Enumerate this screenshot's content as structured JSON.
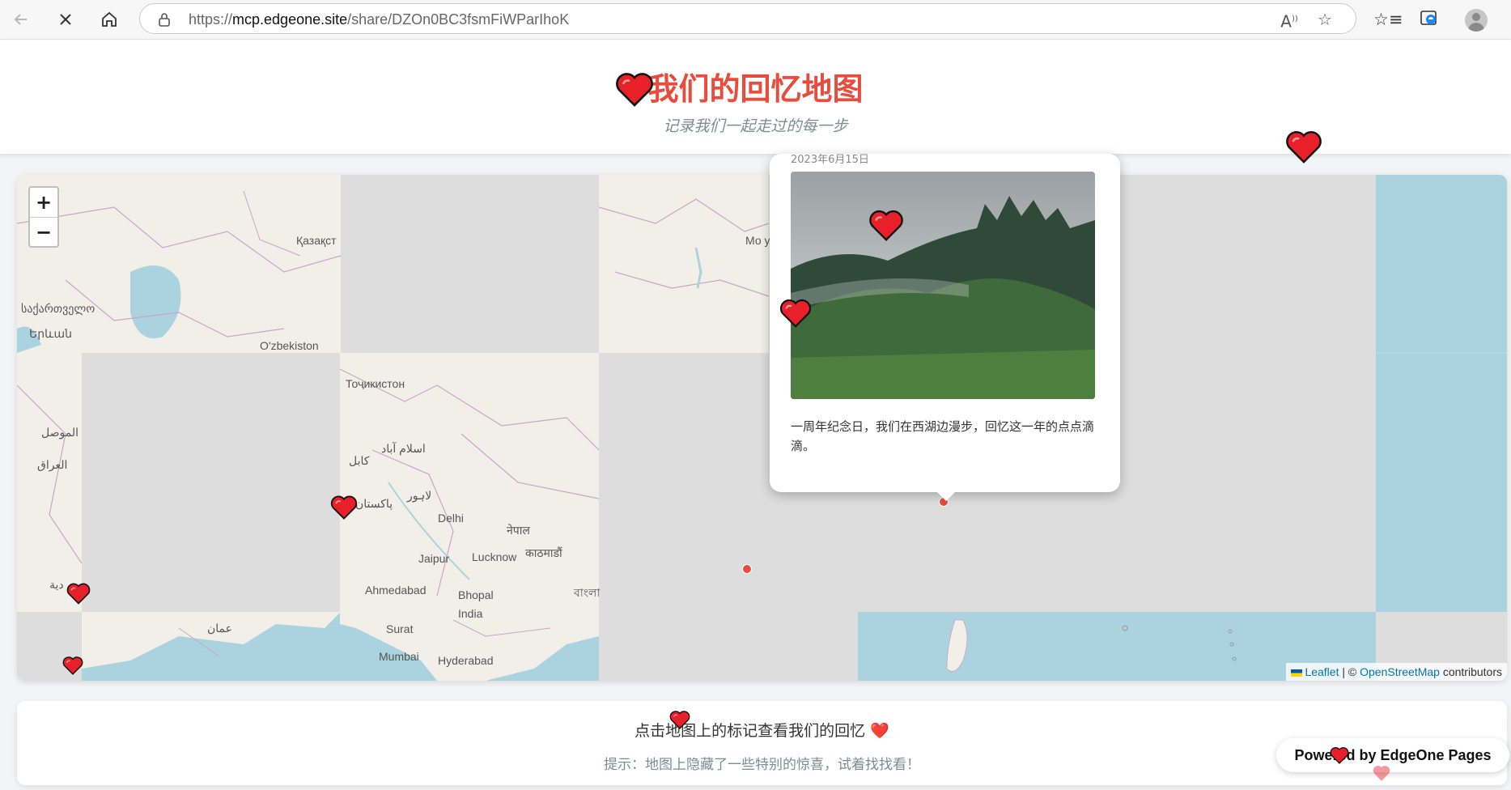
{
  "browser": {
    "url_prefix": "https://",
    "url_host": "mcp.edgeone.site",
    "url_path": "/share/DZOn0BC3fsmFiWParIhoK",
    "icons": [
      "back-icon",
      "close-icon",
      "home-icon",
      "lock-icon",
      "read-aloud-icon",
      "favorite-star-icon",
      "favorites-icon",
      "edge-icon",
      "profile-avatar"
    ]
  },
  "header": {
    "title": "我们的回忆地图",
    "subtitle": "记录我们一起走过的每一步"
  },
  "map": {
    "zoom_in": "+",
    "zoom_out": "−",
    "labels": {
      "kazakh": "Қазақст",
      "georgia": "საქართველო",
      "armenia": "Երևան",
      "uzbekistan": "O'zbekiston",
      "mongolia": "Мо улс",
      "tajikistan": "Тоҷикистон",
      "mosul": "الموصل",
      "iraq": "العراق",
      "islamabad": "اسلام آباد",
      "kabul": "کابل",
      "lahore": "لاہور",
      "pakistan": "پاکستان",
      "delhi": "Delhi",
      "nepal": "नेपाल",
      "kathmandu": "काठमाडौं",
      "jaipur": "Jaipur",
      "lucknow": "Lucknow",
      "ahmedabad": "Ahmedabad",
      "bhopal": "Bhopal",
      "india": "India",
      "bangla": "বাংলা",
      "oman": "عمان",
      "surat": "Surat",
      "mumbai": "Mumbai",
      "hyderabad": "Hyderabad",
      "saudi": "دية"
    },
    "attribution": {
      "leaflet": "Leaflet",
      "separator": " | © ",
      "osm": "OpenStreetMap",
      "suffix": " contributors"
    },
    "popup": {
      "date": "2023年6月15日",
      "text": "一周年纪念日，我们在西湖边漫步，回忆这一年的点点滴滴。"
    }
  },
  "footer": {
    "main": "点击地图上的标记查看我们的回忆 ❤️",
    "hint": "提示：地图上隐藏了一些特别的惊喜，试着找找看！"
  },
  "badge": "Powered by EdgeOne Pages",
  "colors": {
    "accent": "#e74c3c",
    "subtitle": "#7f8c8d",
    "water": "#aad3df",
    "land": "#f2efe9",
    "missing_tile": "#dddddd"
  }
}
